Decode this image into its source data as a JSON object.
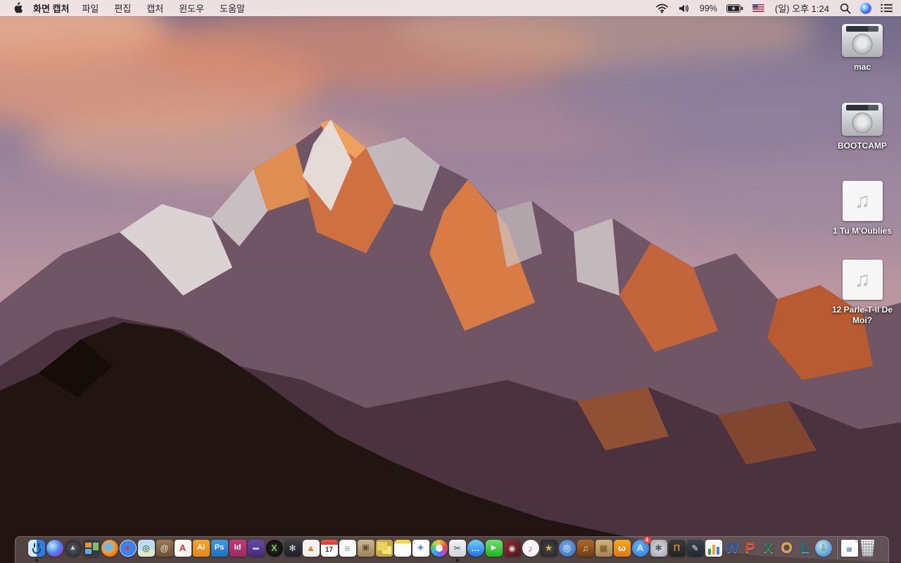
{
  "menu_bar": {
    "app_name": "화면 캡처",
    "menus": [
      "파일",
      "편집",
      "캡처",
      "윈도우",
      "도움말"
    ],
    "battery_percent": "99%",
    "clock": "(일) 오후 1:24",
    "status_icons": [
      "wifi-icon",
      "volume-icon",
      "battery-charging-icon",
      "us-flag-input-icon",
      "spotlight-search-icon",
      "siri-icon",
      "notification-center-icon"
    ],
    "colors": {
      "bar_bg": "#f0e5e5",
      "text": "#28242a"
    }
  },
  "desktop": {
    "audio_glyph": "♫",
    "icons": [
      {
        "id": "mac",
        "label": "mac",
        "type": "drive"
      },
      {
        "id": "bootcamp",
        "label": "BOOTCAMP",
        "type": "drive"
      },
      {
        "id": "song-1",
        "label": "1 Tu M'Oublies",
        "type": "audio"
      },
      {
        "id": "song-12",
        "label": "12 Parle-T-Il De Moi?",
        "type": "audio"
      }
    ]
  },
  "dock": {
    "items": [
      {
        "id": "finder",
        "glyph": "",
        "bg": "linear-gradient(90deg,#cfe9fa 0 50%, #2e7de0 50%)",
        "radius": "6px",
        "running": true
      },
      {
        "id": "siri",
        "glyph": "",
        "bg": "radial-gradient(circle at 35% 35%, #bfe9ff, #4f8cf0 45%, #8a3bd8 78%, #141a3a)",
        "radius": "50%"
      },
      {
        "id": "launchpad",
        "glyph": "▲",
        "fg": "#d2d6dc",
        "size": 10,
        "bg": "radial-gradient(circle,#585c64,#2b2e34 75%)",
        "radius": "50%"
      },
      {
        "id": "mission-control",
        "glyph": "",
        "bg": "linear-gradient(#e8923a,#e8923a) 3px 4px/9px 7px no-repeat, linear-gradient(#7ac06a,#7ac06a) 14px 4px/8px 11px no-repeat, linear-gradient(#6aa8e0,#6aa8e0) 3px 13px/9px 7px no-repeat, #343944",
        "radius": "5px"
      },
      {
        "id": "firefox",
        "glyph": "",
        "bg": "radial-gradient(circle at 42% 42%, #6fb8e8 0 26%, #f2a23c 40%, #e87f1e 62%, #cf5f12 100%)",
        "radius": "50%"
      },
      {
        "id": "safari",
        "glyph": "◆",
        "fg": "#e03a30",
        "size": 9,
        "bg": "radial-gradient(circle at 50% 50%, #3b82f0 0 66%, #e8eef5 66%)",
        "radius": "50%"
      },
      {
        "id": "preview",
        "glyph": "◎",
        "fg": "#3a3f44",
        "size": 12,
        "bg": "linear-gradient(180deg,#bcdcf0 0 60%, #dce9c8 60%)",
        "radius": "5px"
      },
      {
        "id": "contacts",
        "glyph": "@",
        "fg": "#f0e8d8",
        "size": 12,
        "bg": "linear-gradient(180deg,#9a7850,#6e5236)",
        "radius": "4px"
      },
      {
        "id": "acrobat-reader",
        "glyph": "A",
        "fg": "#d8342a",
        "size": 13,
        "bold": true,
        "bg": "#f5f5f5",
        "radius": "4px"
      },
      {
        "id": "illustrator",
        "glyph": "Ai",
        "fg": "#ffffff",
        "size": 11,
        "bold": true,
        "bg": "linear-gradient(180deg,#f5a62a,#e8851a)",
        "radius": "4px"
      },
      {
        "id": "photoshop",
        "glyph": "Ps",
        "fg": "#ffffff",
        "size": 11,
        "bold": true,
        "bg": "linear-gradient(180deg,#3f9be0,#1f6fc0)",
        "radius": "4px"
      },
      {
        "id": "indesign",
        "glyph": "Id",
        "fg": "#ffffff",
        "size": 11,
        "bold": true,
        "bg": "linear-gradient(180deg,#c43a7a,#9c2a60)",
        "radius": "4px"
      },
      {
        "id": "toast",
        "glyph": "▬",
        "fg": "#cfc6ee",
        "size": 9,
        "bg": "linear-gradient(180deg,#6a4aa8,#432a78)",
        "radius": "5px"
      },
      {
        "id": "xee",
        "glyph": "X",
        "fg": "#7ac943",
        "size": 13,
        "bold": true,
        "bg": "radial-gradient(circle,#2e2e2e,#000000)",
        "radius": "50%"
      },
      {
        "id": "disk-utility",
        "glyph": "✻",
        "fg": "#e6e8ea",
        "size": 12,
        "bg": "linear-gradient(180deg,#3a3e45,#1e2126)",
        "radius": "5px"
      },
      {
        "id": "vlc",
        "glyph": "▲",
        "fg": "#f07f1a",
        "size": 13,
        "bg": "#f2f2f0",
        "radius": "5px"
      },
      {
        "id": "calendar",
        "glyph": "17",
        "fg": "#333333",
        "size": 10,
        "bg": "#ffffff",
        "radius": "5px"
      },
      {
        "id": "reminders",
        "glyph": "≡",
        "fg": "#9aa0a6",
        "size": 14,
        "bg": "#fafafa",
        "radius": "5px"
      },
      {
        "id": "mail-drop-box",
        "glyph": "▣",
        "fg": "#5c4830",
        "size": 11,
        "bg": "linear-gradient(180deg,#cbb693,#a18559)",
        "radius": "4px"
      },
      {
        "id": "stickies",
        "glyph": "",
        "bg": "linear-gradient(#e8d45a,#e8d45a) 2px 3px/14px 12px no-repeat, linear-gradient(#f5e87a,#f5e87a) 9px 9px/13px 11px no-repeat, #c9a94a",
        "radius": "4px"
      },
      {
        "id": "notes",
        "glyph": "",
        "bg": "linear-gradient(180deg,#f5d94a 0 22%, #fdfdfb 22%)",
        "radius": "5px"
      },
      {
        "id": "documents",
        "glyph": "◈",
        "fg": "#4a7fd0",
        "size": 11,
        "bg": "#fcfcfc",
        "radius": "4px"
      },
      {
        "id": "photos",
        "glyph": "",
        "bg": "conic-gradient(#f5b942,#ef7d33,#e8434a,#c24cb0,#7b5ff0,#3e8ef7,#3bb7e8,#52c77a,#b4d44a,#f5b942)",
        "radius": "50%"
      },
      {
        "id": "grab",
        "glyph": "✂",
        "fg": "#4a4f55",
        "size": 12,
        "bg": "linear-gradient(180deg,#f2f4f6,#cfd4d9)",
        "radius": "5px",
        "running": true
      },
      {
        "id": "messages",
        "glyph": "…",
        "fg": "#ffffff",
        "size": 13,
        "bold": true,
        "bg": "linear-gradient(180deg,#6fd4fb,#1d70f2)",
        "radius": "50%"
      },
      {
        "id": "facetime",
        "glyph": "▶",
        "fg": "#ffffff",
        "size": 10,
        "bg": "linear-gradient(180deg,#6de26b,#1fb31f)",
        "radius": "6px"
      },
      {
        "id": "photo-booth",
        "glyph": "◉",
        "fg": "#e8d0d0",
        "size": 12,
        "bg": "linear-gradient(135deg,#8a2f35,#4a181c)",
        "radius": "5px"
      },
      {
        "id": "itunes",
        "glyph": "♪",
        "fg": "#e8508a",
        "size": 14,
        "bg": "radial-gradient(circle,#ffffff,#e9e9ef)",
        "radius": "50%"
      },
      {
        "id": "imovie",
        "glyph": "★",
        "fg": "#d8b64a",
        "size": 13,
        "bg": "radial-gradient(circle,#46464a,#232326)",
        "radius": "5px"
      },
      {
        "id": "dvd-player",
        "glyph": "◎",
        "fg": "#e8f0fa",
        "size": 13,
        "bg": "radial-gradient(circle at 45% 40%, #7ab0e8, #2a62b8)",
        "radius": "50%"
      },
      {
        "id": "garageband",
        "glyph": "♫",
        "fg": "#f5e8d8",
        "size": 12,
        "bg": "linear-gradient(180deg,#b06a28,#6e3c12)",
        "radius": "5px"
      },
      {
        "id": "clippings-board",
        "glyph": "▦",
        "fg": "#6e4f28",
        "size": 12,
        "bg": "linear-gradient(180deg,#d2b278,#a8854e)",
        "radius": "4px"
      },
      {
        "id": "ibooks",
        "glyph": "ω",
        "fg": "#ffffff",
        "size": 13,
        "bold": true,
        "bg": "linear-gradient(180deg,#f5a623,#e07b12)",
        "radius": "5px"
      },
      {
        "id": "app-store",
        "glyph": "A",
        "fg": "#ffffff",
        "size": 13,
        "bg": "radial-gradient(circle at 45% 40%, #6db2f5, #1f7ae0)",
        "radius": "50%",
        "badge": "4"
      },
      {
        "id": "system-preferences",
        "glyph": "✱",
        "fg": "#5a5f66",
        "size": 13,
        "bg": "radial-gradient(circle,#e3e5e8,#9aa0a8)",
        "radius": "5px"
      },
      {
        "id": "keynote",
        "glyph": "Π",
        "fg": "#cf8a2e",
        "size": 13,
        "bold": true,
        "bg": "linear-gradient(180deg,#3a3a38,#232322)",
        "radius": "5px"
      },
      {
        "id": "pages",
        "glyph": "✎",
        "fg": "#e8ecf0",
        "size": 12,
        "bg": "linear-gradient(180deg,#3a4450,#222a34)",
        "radius": "5px"
      },
      {
        "id": "numbers",
        "glyph": "",
        "bg": "linear-gradient(#3a9c3a,#3a9c3a) 4px 13px/4px 8px no-repeat, linear-gradient(#e8a23a,#e8a23a) 10px 7px/4px 14px no-repeat, linear-gradient(#4a7fd0,#4a7fd0) 16px 10px/4px 11px no-repeat, #f5f6f7",
        "radius": "4px"
      },
      {
        "id": "word",
        "glyph": "W",
        "fg": "#2b579a",
        "letter": true
      },
      {
        "id": "powerpoint",
        "glyph": "P",
        "fg": "#d1452e",
        "letter": true
      },
      {
        "id": "excel",
        "glyph": "X",
        "fg": "#1e7145",
        "letter": true
      },
      {
        "id": "outlook",
        "glyph": "O",
        "fg": "#e8a33d",
        "letter": true
      },
      {
        "id": "lync",
        "glyph": "L",
        "fg": "#00797f",
        "letter": true
      },
      {
        "id": "downloader",
        "glyph": "⇩",
        "fg": "#3fae4a",
        "size": 13,
        "bold": true,
        "bg": "radial-gradient(circle at 40% 35%, #cfe6f5, #5a9fd8 65%, #2a6aa8)",
        "radius": "50%"
      },
      {
        "type": "separator"
      },
      {
        "id": "image-document",
        "glyph": "▄",
        "fg": "#7fa8cc",
        "size": 10,
        "bg": "#fbfbfb",
        "radius": "2px"
      },
      {
        "id": "trash",
        "glyph": ""
      }
    ]
  }
}
